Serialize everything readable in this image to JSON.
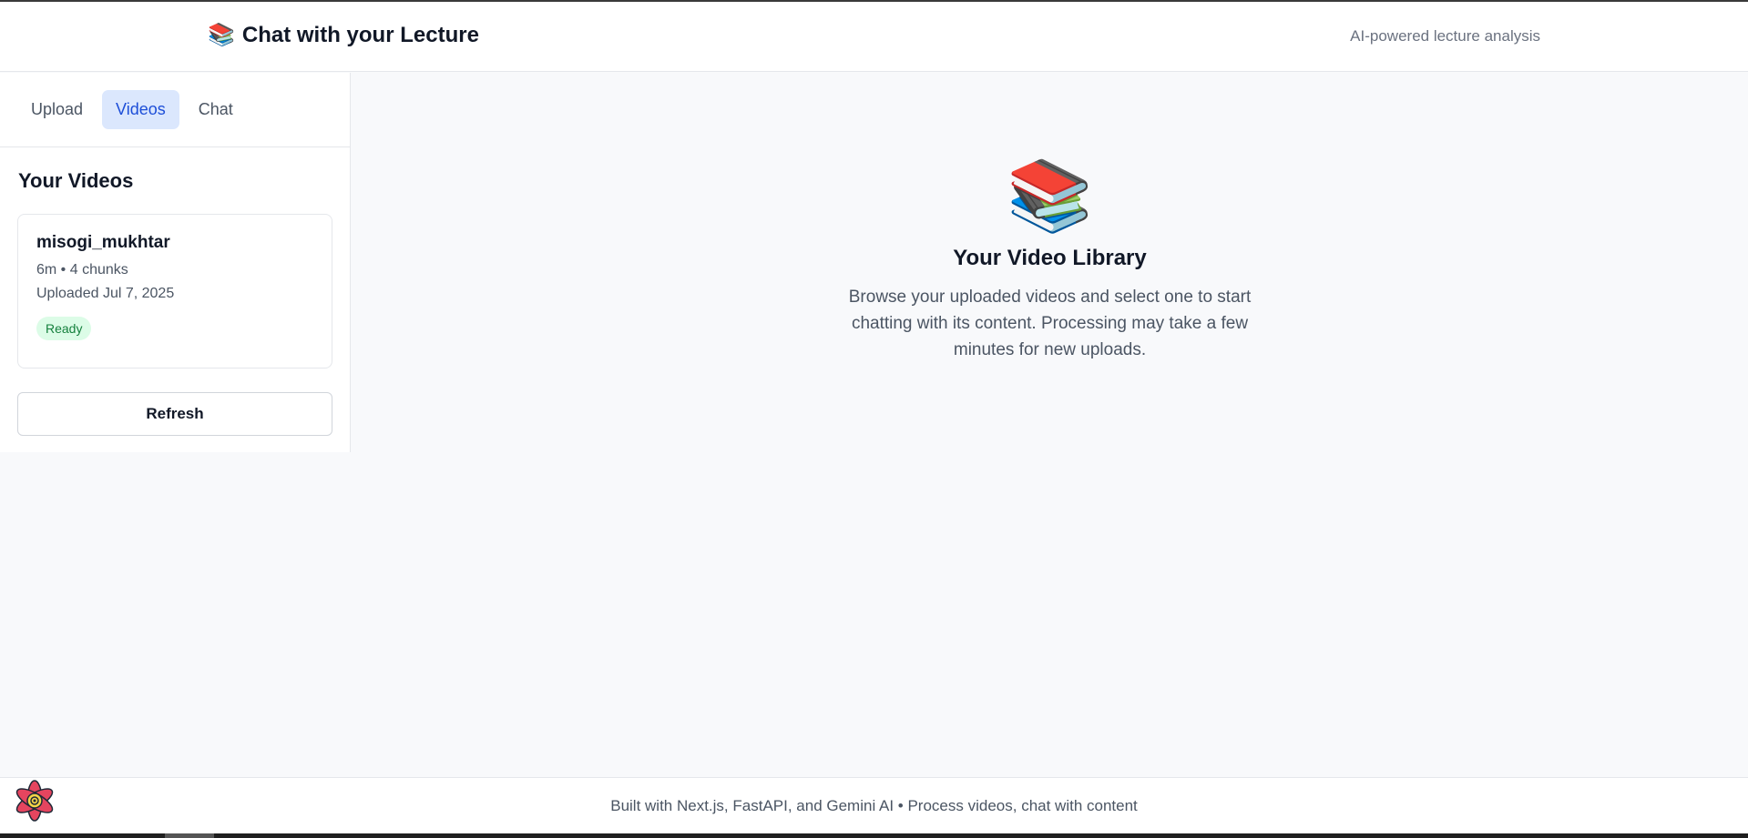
{
  "header": {
    "brand_icon": "📚",
    "title": "Chat with your Lecture",
    "tagline": "AI-powered lecture analysis"
  },
  "sidebar": {
    "tabs": [
      {
        "label": "Upload",
        "active": false
      },
      {
        "label": "Videos",
        "active": true
      },
      {
        "label": "Chat",
        "active": false
      }
    ],
    "section_title": "Your Videos",
    "videos": [
      {
        "name": "misogi_mukhtar",
        "meta": "6m • 4 chunks",
        "uploaded": "Uploaded Jul 7, 2025",
        "status": "Ready"
      }
    ],
    "refresh_label": "Refresh"
  },
  "main": {
    "icon": "📚",
    "title": "Your Video Library",
    "description": "Browse your uploaded videos and select one to start chatting with its content. Processing may take a few minutes for new uploads."
  },
  "footer": {
    "text": "Built with Next.js, FastAPI, and Gemini AI • Process videos, chat with content"
  },
  "colors": {
    "accent": "#1d4ed8",
    "accent_bg": "#dbe7fd",
    "ready_bg": "#dcfce7",
    "ready_text": "#15803d",
    "react_logo": "#e5455f"
  }
}
